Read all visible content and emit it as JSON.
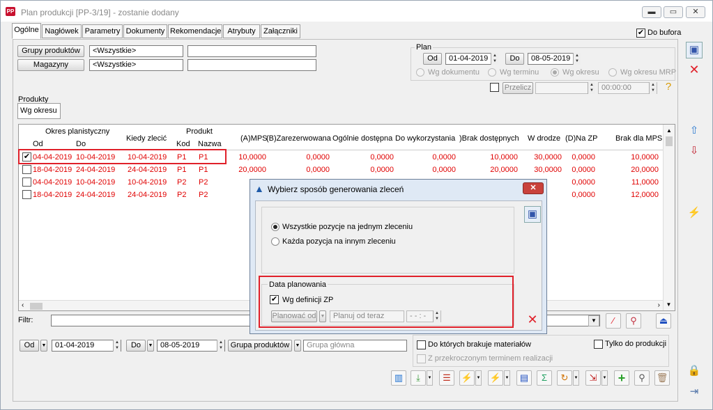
{
  "window": {
    "title": "Plan produkcji [PP-3/19] - zostanie dodany",
    "app_icon": "PP",
    "minimize_glyph": "▬",
    "maximize_glyph": "▭",
    "close_glyph": "✕"
  },
  "tabs": [
    "Ogólne",
    "Nagłówek",
    "Parametry",
    "Dokumenty",
    "Rekomendacje",
    "Atrybuty",
    "Załączniki"
  ],
  "do_bufora": {
    "label": "Do bufora",
    "checked": true
  },
  "filters_top": {
    "grupy_button": "Grupy produktów",
    "grupy_value": "<Wszystkie>",
    "magazyny_button": "Magazyny",
    "magazyny_value": "<Wszystkie>"
  },
  "plan": {
    "legend": "Plan",
    "od_label": "Od",
    "od_value": "01-04-2019",
    "do_label": "Do",
    "do_value": "08-05-2019",
    "radios": [
      "Wg dokumentu",
      "Wg terminu",
      "Wg okresu",
      "Wg okresu MRP"
    ],
    "selected_radio": "Wg okresu",
    "przelicz_label": "Przelicz",
    "time_value": "00:00:00"
  },
  "produkty": {
    "legend": "Produkty",
    "subtab": "Wg okresu"
  },
  "grid": {
    "headers": {
      "okres": "Okres planistyczny",
      "od": "Od",
      "do": "Do",
      "kiedy": "Kiedy zlecić",
      "produkt": "Produkt",
      "kod": "Kod",
      "nazwa": "Nazwa",
      "mps": "(A)MPS",
      "zarezerwowana": "(B)Zarezerwowana",
      "dostepna": "Ogólnie dostępna",
      "do_wykorzystania": "Do wykorzystania",
      "brak_dostepnych": ")Brak dostępnych",
      "w_drodze": "W drodze",
      "na_zp": "(D)Na ZP",
      "brak_mps": "Brak dla MPS"
    },
    "rows": [
      {
        "checked": true,
        "od": "04-04-2019",
        "do": "10-04-2019",
        "kiedy": "10-04-2019",
        "kod": "P1",
        "nazwa": "P1",
        "mps": "10,0000",
        "zar": "0,0000",
        "dost": "0,0000",
        "wyk": "0,0000",
        "brak": "10,0000",
        "droga": "30,0000",
        "zp": "0,0000",
        "brak_mps": "10,0000"
      },
      {
        "checked": false,
        "od": "18-04-2019",
        "do": "24-04-2019",
        "kiedy": "24-04-2019",
        "kod": "P1",
        "nazwa": "P1",
        "mps": "20,0000",
        "zar": "0,0000",
        "dost": "0,0000",
        "wyk": "0,0000",
        "brak": "20,0000",
        "droga": "30,0000",
        "zp": "0,0000",
        "brak_mps": "20,0000"
      },
      {
        "checked": false,
        "od": "04-04-2019",
        "do": "10-04-2019",
        "kiedy": "10-04-2019",
        "kod": "P2",
        "nazwa": "P2",
        "mps": "11,0",
        "zar": "",
        "dost": "",
        "wyk": "",
        "brak": "",
        "droga": "",
        "zp": "0,0000",
        "brak_mps": "11,0000"
      },
      {
        "checked": false,
        "od": "18-04-2019",
        "do": "24-04-2019",
        "kiedy": "24-04-2019",
        "kod": "P2",
        "nazwa": "P2",
        "mps": "12,0",
        "zar": "",
        "dost": "",
        "wyk": "",
        "brak": "",
        "droga": "",
        "zp": "0,0000",
        "brak_mps": "12,0000"
      }
    ]
  },
  "filtr": {
    "label": "Filtr:"
  },
  "bottom_filters": {
    "od_label": "Od",
    "od_value": "01-04-2019",
    "do_label": "Do",
    "do_value": "08-05-2019",
    "grupa_label": "Grupa produktów",
    "grupa_placeholder": "Grupa główna",
    "brakuje_label": "Do których brakuje materiałów",
    "tylko_label": "Tylko do produkcji",
    "przekroczonym_label": "Z przekroczonym terminem realizacji"
  },
  "dialog": {
    "title": "Wybierz sposób generowania zleceń",
    "close_glyph": "✕",
    "options": [
      "Wszystkie pozycje na jednym zleceniu",
      "Każda pozycja na innym zleceniu"
    ],
    "selected": "Wszystkie pozycje na jednym zleceniu",
    "data_legend": "Data planowania",
    "wg_definicji_label": "Wg definicji ZP",
    "wg_definicji_checked": true,
    "planowac_label": "Planować od",
    "planuj_placeholder": "Planuj od teraz",
    "time_placeholder": "- - : -"
  },
  "colors": {
    "accent_red": "#e0202a",
    "row_text": "#e00000",
    "title_bg": "#dfe9f5"
  }
}
